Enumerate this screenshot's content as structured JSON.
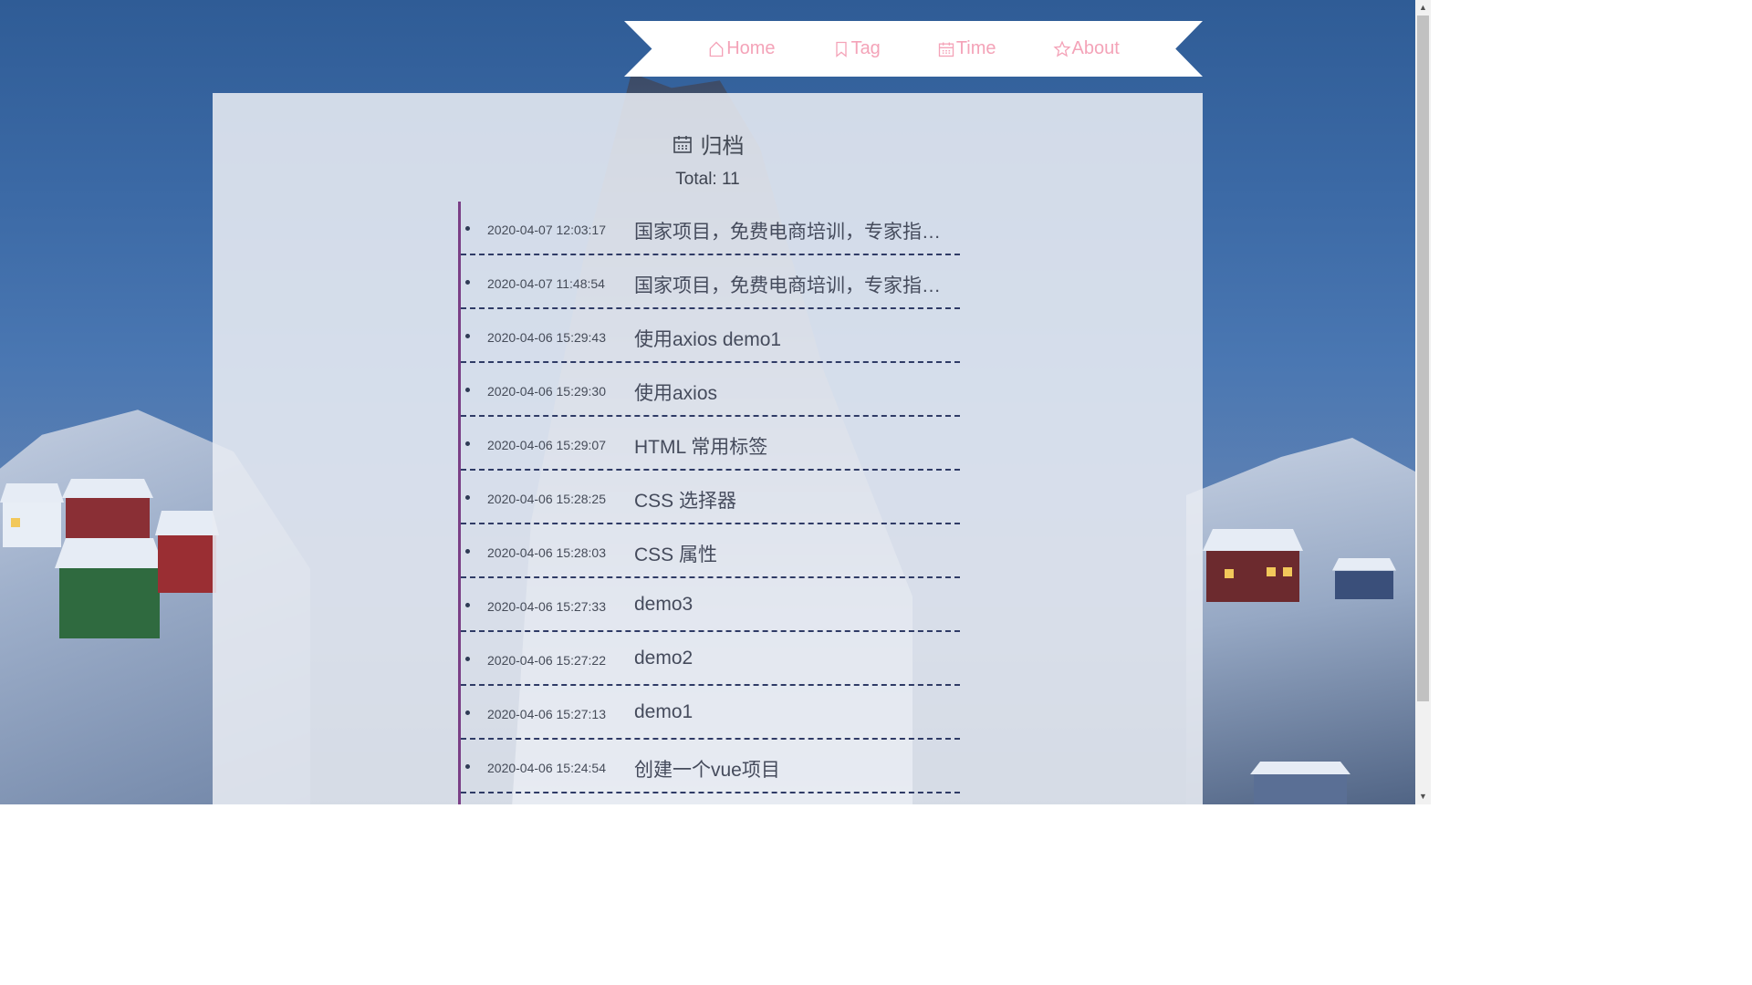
{
  "nav": {
    "items": [
      {
        "label": "Home",
        "icon": "home-icon"
      },
      {
        "label": "Tag",
        "icon": "bookmark-icon"
      },
      {
        "label": "Time",
        "icon": "calendar-icon"
      },
      {
        "label": "About",
        "icon": "star-icon"
      }
    ],
    "color": "#f4a3b8"
  },
  "archive": {
    "title": "归档",
    "total_label": "Total: 11",
    "accent": "#7a3f86",
    "entries": [
      {
        "date": "2020-04-07 12:03:17",
        "title": "国家项目，免费电商培训，专家指导..."
      },
      {
        "date": "2020-04-07 11:48:54",
        "title": "国家项目，免费电商培训，专家指导..."
      },
      {
        "date": "2020-04-06 15:29:43",
        "title": "使用axios demo1"
      },
      {
        "date": "2020-04-06 15:29:30",
        "title": "使用axios"
      },
      {
        "date": "2020-04-06 15:29:07",
        "title": "HTML 常用标签"
      },
      {
        "date": "2020-04-06 15:28:25",
        "title": "CSS 选择器"
      },
      {
        "date": "2020-04-06 15:28:03",
        "title": "CSS 属性"
      },
      {
        "date": "2020-04-06 15:27:33",
        "title": "demo3"
      },
      {
        "date": "2020-04-06 15:27:22",
        "title": "demo2"
      },
      {
        "date": "2020-04-06 15:27:13",
        "title": "demo1"
      },
      {
        "date": "2020-04-06 15:24:54",
        "title": "创建一个vue项目"
      }
    ]
  }
}
